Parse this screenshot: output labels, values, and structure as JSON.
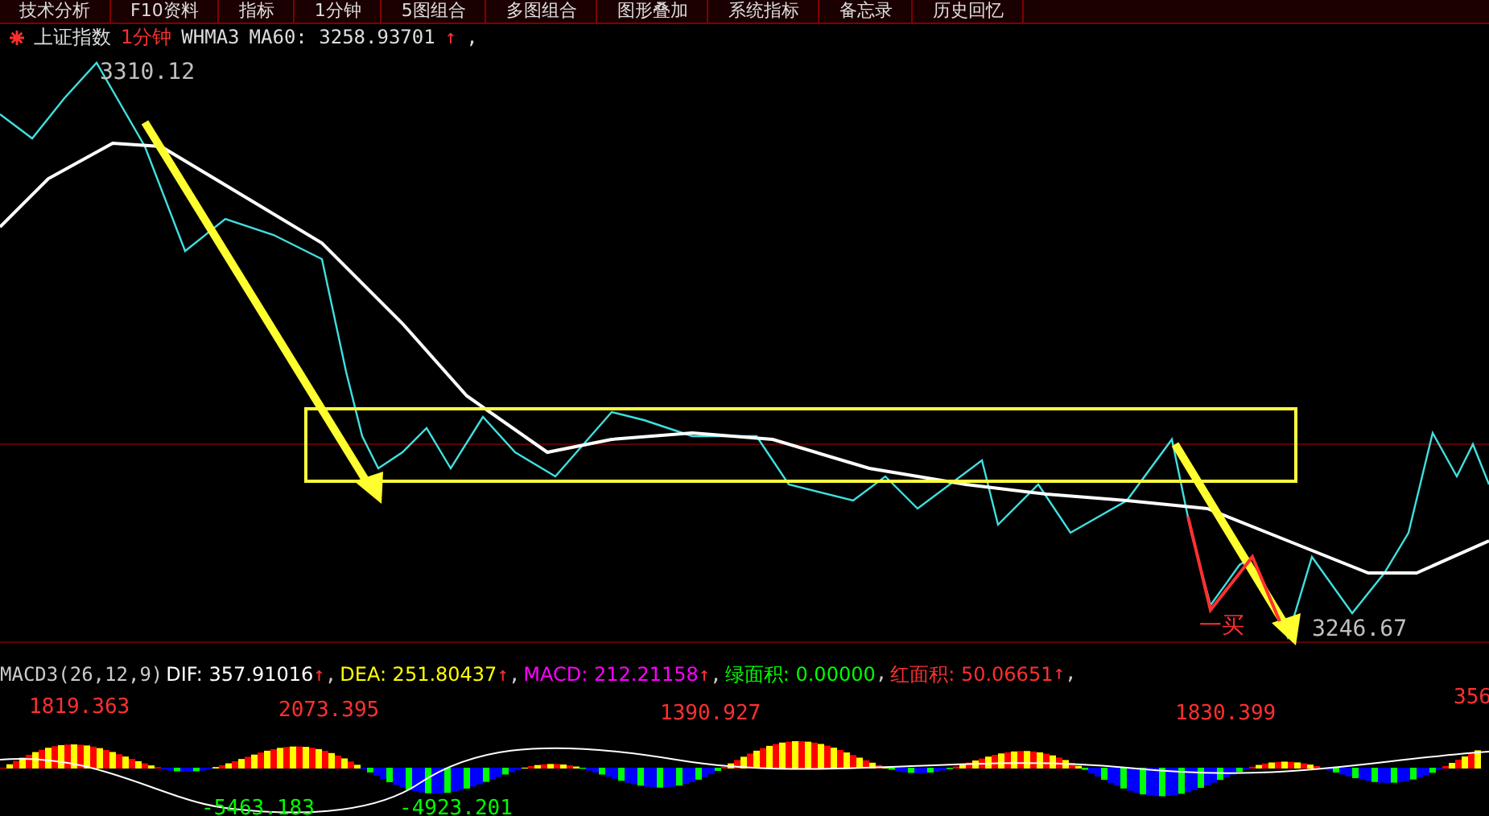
{
  "toolbar": {
    "tabs": [
      {
        "label": "技术分析"
      },
      {
        "label": "F10资料"
      },
      {
        "label": "指标"
      },
      {
        "label": "1分钟"
      },
      {
        "label": "5图组合"
      },
      {
        "label": "多图组合"
      },
      {
        "label": "图形叠加"
      },
      {
        "label": "系统指标"
      },
      {
        "label": "备忘录"
      },
      {
        "label": "历史回忆"
      }
    ]
  },
  "price_header": {
    "symbol": "上证指数",
    "period": "1分钟",
    "indicator": "WHMA3",
    "ma": "MA60: 3258.93701",
    "arrow": "↑",
    "separator": ","
  },
  "price_chart": {
    "annotations": [
      {
        "kind": "high",
        "text": "3310.12"
      },
      {
        "kind": "low",
        "text": "3246.67"
      },
      {
        "kind": "signal",
        "text": "一买"
      }
    ]
  },
  "macd_header": {
    "name": "MACD3(26,12,9)",
    "items": [
      {
        "text": "DIF: 357.91016",
        "color": "#ffffff",
        "arrow": "↑",
        "separator": ","
      },
      {
        "text": "DEA: 251.80437",
        "color": "#ffff00",
        "arrow": "↑",
        "separator": ","
      },
      {
        "text": "MACD: 212.21158",
        "color": "#ff00ff",
        "arrow": "↑",
        "separator": ","
      },
      {
        "text": "绿面积: 0.00000",
        "color": "#00ff00",
        "separator": ","
      },
      {
        "text": "红面积: 50.06651",
        "color": "#ff3030",
        "arrow": "↑",
        "separator": ","
      }
    ]
  },
  "macd_chart": {
    "labels": [
      {
        "text": "1819.363",
        "kind": "peak"
      },
      {
        "text": "2073.395",
        "kind": "peak"
      },
      {
        "text": "-5463.183",
        "kind": "trough"
      },
      {
        "text": "-4923.201",
        "kind": "trough"
      },
      {
        "text": "1390.927",
        "kind": "peak"
      },
      {
        "text": "1830.399",
        "kind": "peak"
      },
      {
        "text": "356",
        "kind": "peak"
      }
    ]
  }
}
